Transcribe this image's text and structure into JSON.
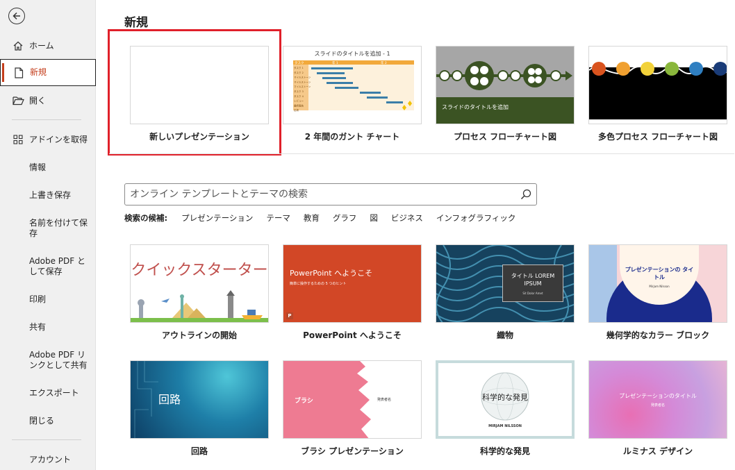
{
  "sidebar": {
    "nav": [
      {
        "label": "ホーム"
      },
      {
        "label": "新規"
      },
      {
        "label": "開く"
      },
      {
        "label": "アドインを取得"
      },
      {
        "label": "情報"
      },
      {
        "label": "上書き保存"
      },
      {
        "label": "名前を付けて保存"
      },
      {
        "label": "Adobe PDF として保存"
      },
      {
        "label": "印刷"
      },
      {
        "label": "共有"
      },
      {
        "label": "Adobe PDF リンクとして共有"
      },
      {
        "label": "エクスポート"
      },
      {
        "label": "閉じる"
      },
      {
        "label": "アカウント"
      }
    ]
  },
  "main": {
    "title": "新規",
    "featured": [
      {
        "label": "新しいプレゼンテーション"
      },
      {
        "label": "2 年間のガント チャート",
        "thumb_title": "スライドのタイトルを追加 - 1",
        "gantt_rows": [
          "タスク 1",
          "タスク 2",
          "マイルストーン",
          "マイルストーン",
          "マイルストーン",
          "タスク 3",
          "タスク 4",
          "レビュー",
          "最終報告",
          "出荷"
        ],
        "gantt_headers": [
          "タスク",
          "年 1",
          "年 2"
        ]
      },
      {
        "label": "プロセス フローチャート図",
        "thumb_title": "スライドのタイトルを追加"
      },
      {
        "label": "多色プロセス フローチャート図"
      }
    ],
    "search": {
      "placeholder": "オンライン テンプレートとテーマの検索"
    },
    "suggestions": {
      "label": "検索の候補:",
      "items": [
        "プレゼンテーション",
        "テーマ",
        "教育",
        "グラフ",
        "図",
        "ビジネス",
        "インフォグラフィック"
      ]
    },
    "templates": [
      {
        "label": "アウトラインの開始",
        "thumb_title": "クイックスターター"
      },
      {
        "label": "PowerPoint へようこそ",
        "thumb_title": "PowerPoint へようこそ",
        "thumb_subtitle": "簡単に操作するための 5 つのヒント",
        "thumb_badge": "P"
      },
      {
        "label": "織物",
        "thumb_title": "タイトル LOREM IPSUM",
        "thumb_subtitle": "Sit Dolor Amet"
      },
      {
        "label": "幾何学的なカラー ブロック",
        "thumb_title": "プレゼンテーションの タイトル",
        "thumb_subtitle": "Mirjam Nilsson"
      },
      {
        "label": "回路",
        "thumb_title": "回路"
      },
      {
        "label": "ブラシ プレゼンテーション",
        "thumb_title": "ブラシ",
        "thumb_subtitle": "発表者名"
      },
      {
        "label": "科学的な発見",
        "thumb_title": "科学的な発見",
        "thumb_subtitle": "MIRJAM NILSSON"
      },
      {
        "label": "ルミナス デザイン",
        "thumb_title": "プレゼンテーションのタイトル",
        "thumb_subtitle": "発表者名"
      }
    ]
  },
  "colors": {
    "accent": "#c43e1c",
    "highlight": "#e0202a",
    "ppt_orange": "#d24726",
    "dark_green": "#3b5323",
    "navy": "#1a2b8c"
  }
}
